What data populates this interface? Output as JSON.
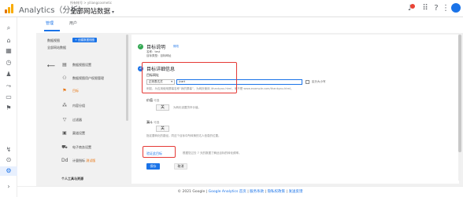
{
  "header": {
    "app_name": "Analytics（分析）",
    "account_path": "所有帐号 > yiliangcosmetic",
    "account_view": "全部网站数据",
    "colors": {
      "brand_orange": "#f9ab00",
      "brand_dark": "#e37400",
      "accent": "#1a73e8"
    },
    "icons": [
      "bell-icon",
      "apps-grid-icon",
      "help-icon",
      "more-vert-icon",
      "account-avatar-icon"
    ]
  },
  "left_nav": {
    "icons": [
      "search-icon",
      "home-icon",
      "customization-icon",
      "realtime-icon",
      "audience-icon",
      "acquisition-icon",
      "behavior-icon",
      "conversions-icon",
      "attribution-icon",
      "discover-icon",
      "admin-gear-icon",
      "expand-icon"
    ]
  },
  "tabs": {
    "admin": "管理",
    "user": "用户"
  },
  "view_column": {
    "view_label": "数据视图",
    "create_view": "+ 创建数据视图",
    "view_name": "全部网站数据"
  },
  "menu": [
    {
      "label": "数据视图设置",
      "icon": "document-icon",
      "active": false
    },
    {
      "label": "数据视图用户权限管理",
      "icon": "users-icon",
      "active": false
    },
    {
      "label": "目标",
      "icon": "flag-icon",
      "active": true
    },
    {
      "label": "内容分组",
      "icon": "content-group-icon",
      "active": false
    },
    {
      "label": "过滤器",
      "icon": "filter-icon",
      "active": false
    },
    {
      "label": "渠道设置",
      "icon": "channel-icon",
      "active": false
    },
    {
      "label": "电子商务设置",
      "icon": "cart-icon",
      "active": false
    },
    {
      "label": "计量指标",
      "beta": "测试版",
      "icon": "calculator-icon",
      "active": false
    }
  ],
  "menu_section": "个人工具与资源",
  "goal": {
    "step1_title": "目标说明",
    "step1_edit": "修改",
    "step1_name": "名称：test",
    "step1_type": "目标类型：目标网址",
    "step2_number": "2",
    "step2_title": "目标详细信息",
    "destination_label": "目标网址",
    "match_type": "正则表达式",
    "destination_value": "/cart",
    "case_sensitive_label": "区分大小写",
    "destination_hint": "例如，为应用使用屏幕名称“我的屏幕”，为网页使用 /thankyou.html，而不是 www.example.com/thankyou.html。",
    "value_label": "价值",
    "value_optional": "可选",
    "value_toggle": "关",
    "value_hint": "为转化设置货币价值。",
    "funnel_label": "漏斗",
    "funnel_optional": "可选",
    "funnel_toggle": "关",
    "funnel_hint": "指定要转化的路径。同这个目标中所转换的达人信息的位置。",
    "verify_link": "验证此目标",
    "verify_hint": "根据您过去 7 天的数据了解此目标的转化频率。",
    "save_button": "保存",
    "cancel_button": "取消"
  },
  "footer": {
    "copyright": "© 2021 Google",
    "links": [
      "Google Analytics 首页",
      "服务条款",
      "隐私权政策",
      "发送反馈"
    ]
  }
}
